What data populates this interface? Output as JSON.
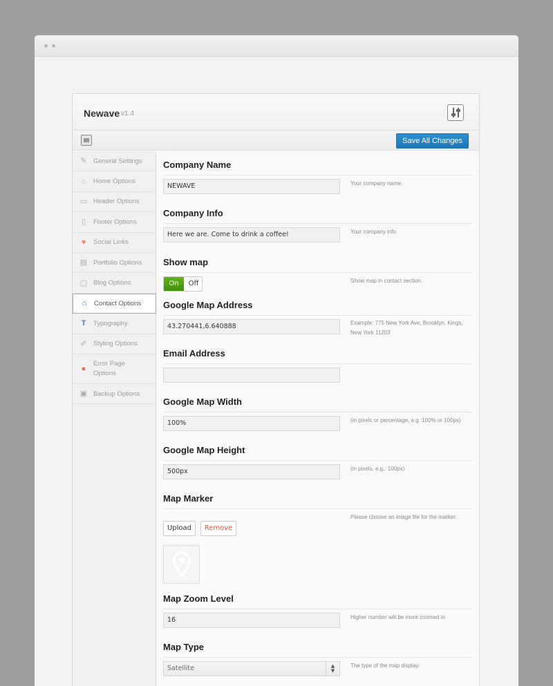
{
  "app": {
    "name": "Newave",
    "version": "v1.4"
  },
  "toolbar": {
    "save_label": "Save All Changes"
  },
  "sidebar": {
    "items": [
      {
        "label": "General Settings",
        "icon": "wrench-icon"
      },
      {
        "label": "Home Options",
        "icon": "home-icon"
      },
      {
        "label": "Header Options",
        "icon": "header-icon"
      },
      {
        "label": "Footer Options",
        "icon": "footer-icon"
      },
      {
        "label": "Social Links",
        "icon": "heart-icon"
      },
      {
        "label": "Portfolio Options",
        "icon": "image-icon"
      },
      {
        "label": "Blog Options",
        "icon": "document-icon"
      },
      {
        "label": "Contact Options",
        "icon": "home-icon",
        "active": true
      },
      {
        "label": "Typography",
        "icon": "text-icon"
      },
      {
        "label": "Styling Options",
        "icon": "brush-icon"
      },
      {
        "label": "Error Page Options",
        "icon": "error-icon"
      },
      {
        "label": "Backup Options",
        "icon": "backup-icon"
      }
    ]
  },
  "fields": {
    "company_name": {
      "title": "Company Name",
      "value": "NEWAVE",
      "desc": "Your company name"
    },
    "company_info": {
      "title": "Company Info",
      "value": "Here we are. Come to drink a coffee!",
      "desc": "Your company info"
    },
    "show_map": {
      "title": "Show map",
      "on": "On",
      "off": "Off",
      "state": "on",
      "desc": "Show map in contact section."
    },
    "map_address": {
      "title": "Google Map Address",
      "value": "43.270441,6.640888",
      "desc": "Example: 775 New York Ave, Brooklyn, Kings, New York 11203"
    },
    "email": {
      "title": "Email Address",
      "value": ""
    },
    "map_width": {
      "title": "Google Map Width",
      "value": "100%",
      "desc": "(in pixels or percentage, e.g.:100% or 100px)"
    },
    "map_height": {
      "title": "Google Map Height",
      "value": "500px",
      "desc": "(in pixels, e.g.: 100px)"
    },
    "map_marker": {
      "title": "Map Marker",
      "upload": "Upload",
      "remove": "Remove",
      "desc": "Please choose an image file for the marker."
    },
    "zoom": {
      "title": "Map Zoom Level",
      "value": "16",
      "desc": "Higher number will be more zoomed in"
    },
    "map_type": {
      "title": "Map Type",
      "value": "Satellite",
      "desc": "The type of the map display."
    }
  },
  "colors": {
    "accent": "#1b76b8",
    "toggle_on": "#4a9a10",
    "remove": "#e05a3a"
  }
}
